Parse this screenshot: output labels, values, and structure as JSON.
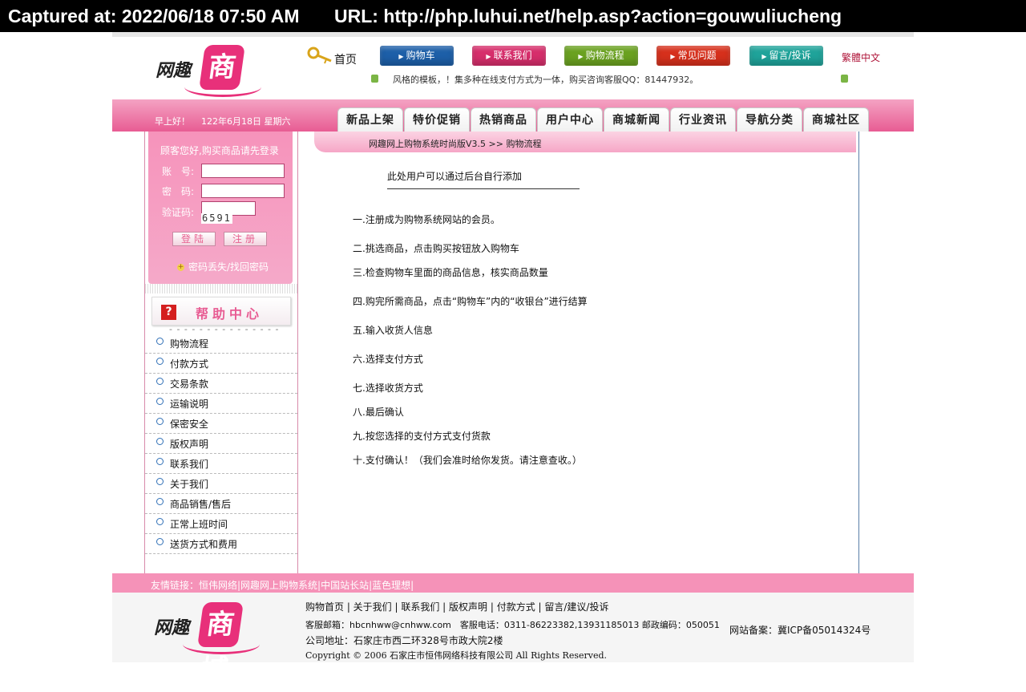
{
  "capture": {
    "captured_at": "Captured at: 2022/06/18 07:50 AM",
    "url": "URL: http://php.luhui.net/help.asp?action=gouwuliucheng"
  },
  "logo": {
    "part1": "网趣",
    "part2": "商城"
  },
  "top": {
    "home": "首页",
    "buttons": [
      "购物车",
      "联系我们",
      "购物流程",
      "常见问题",
      "留言/投诉"
    ],
    "lang": "繁體中文",
    "marquee": "风格的模板，！集多种在线支付方式为一体，购买咨询客服QQ：81447932。"
  },
  "band": {
    "greeting": "早上好！",
    "date": "122年6月18日 星期六"
  },
  "tabs": [
    "新品上架",
    "特价促销",
    "热销商品",
    "用户中心",
    "商城新闻",
    "行业资讯",
    "导航分类",
    "商城社区"
  ],
  "login": {
    "title": "顾客您好,购买商品请先登录",
    "account_label": "账　号:",
    "password_label": "密　码:",
    "captcha_label": "验证码:",
    "captcha_value": "6591",
    "login_btn": "登陆",
    "register_btn": "注册",
    "forgot": "密码丢失/找回密码"
  },
  "help": {
    "title": "帮助中心",
    "divider": "- - - - - - - - - - - - - - -",
    "items": [
      "购物流程",
      "付款方式",
      "交易条款",
      "运输说明",
      "保密安全",
      "版权声明",
      "联系我们",
      "关于我们",
      "商品销售/售后",
      "正常上班时间",
      "送货方式和费用"
    ]
  },
  "main": {
    "breadcrumb": "网趣网上购物系统时尚版V3.5 >> 购物流程",
    "note": "此处用户可以通过后台自行添加",
    "steps": [
      "一.注册成为购物系统网站的会员。",
      "二.挑选商品，点击购买按钮放入购物车",
      "三.检查购物车里面的商品信息，核实商品数量",
      "四.购完所需商品，点击“购物车”内的“收银台”进行结算",
      "五.输入收货人信息",
      "六.选择支付方式",
      "七.选择收货方式",
      "八.最后确认",
      "九.按您选择的支付方式支付货款",
      "十.支付确认！（我们会准时给你发货。请注意查收。）"
    ]
  },
  "friend_links": "友情链接：恒伟网络|网趣网上购物系统|中国站长站|蓝色理想|",
  "footer": {
    "nav": "购物首页 | 关于我们 | 联系我们 | 版权声明 | 付款方式 | 留言/建议/投诉",
    "contact": "客服邮箱：hbcnhww@cnhww.com　客服电话：0311-86223382,13931185013 邮政编码：050051",
    "address": "公司地址：石家庄市西二环328号市政大院2楼",
    "beian": "网站备案：冀ICP备05014324号",
    "copyright": "Copyright © 2006 石家庄市恒伟网络科技有限公司 All Rights Reserved."
  }
}
